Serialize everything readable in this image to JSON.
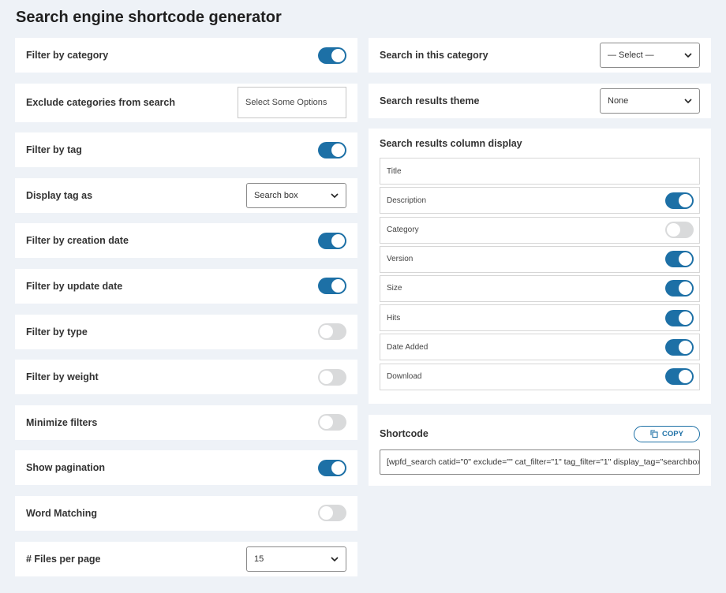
{
  "page": {
    "title": "Search engine shortcode generator"
  },
  "left": {
    "filter_by_category": {
      "label": "Filter by category",
      "on": true
    },
    "exclude_categories": {
      "label": "Exclude categories from search",
      "placeholder": "Select Some Options"
    },
    "filter_by_tag": {
      "label": "Filter by tag",
      "on": true
    },
    "display_tag_as": {
      "label": "Display tag as",
      "value": "Search box"
    },
    "filter_by_creation_date": {
      "label": "Filter by creation date",
      "on": true
    },
    "filter_by_update_date": {
      "label": "Filter by update date",
      "on": true
    },
    "filter_by_type": {
      "label": "Filter by type",
      "on": false
    },
    "filter_by_weight": {
      "label": "Filter by weight",
      "on": false
    },
    "minimize_filters": {
      "label": "Minimize filters",
      "on": false
    },
    "show_pagination": {
      "label": "Show pagination",
      "on": true
    },
    "word_matching": {
      "label": "Word Matching",
      "on": false
    },
    "files_per_page": {
      "label": "# Files per page",
      "value": "15"
    }
  },
  "right": {
    "search_in_category": {
      "label": "Search in this category",
      "value": "— Select —"
    },
    "results_theme": {
      "label": "Search results theme",
      "value": "None"
    },
    "column_display": {
      "title": "Search results column display",
      "items": [
        {
          "label": "Title",
          "has_toggle": false,
          "on": false
        },
        {
          "label": "Description",
          "has_toggle": true,
          "on": true
        },
        {
          "label": "Category",
          "has_toggle": true,
          "on": false
        },
        {
          "label": "Version",
          "has_toggle": true,
          "on": true
        },
        {
          "label": "Size",
          "has_toggle": true,
          "on": true
        },
        {
          "label": "Hits",
          "has_toggle": true,
          "on": true
        },
        {
          "label": "Date Added",
          "has_toggle": true,
          "on": true
        },
        {
          "label": "Download",
          "has_toggle": true,
          "on": true
        }
      ]
    },
    "shortcode": {
      "title": "Shortcode",
      "copy_label": "COPY",
      "value": "[wpfd_search catid=\"0\" exclude=\"\" cat_filter=\"1\" tag_filter=\"1\" display_tag=\"searchbox\""
    }
  },
  "colors": {
    "accent": "#1d70a6",
    "toggle_off": "#d9dadb",
    "background": "#eef2f7"
  }
}
